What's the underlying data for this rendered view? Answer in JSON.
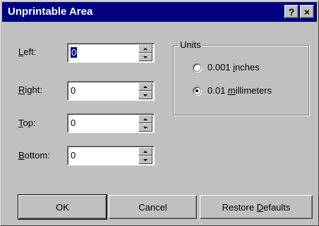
{
  "window": {
    "title": "Unprintable Area",
    "help_label": "?",
    "close_label": "×"
  },
  "fields": {
    "left": {
      "label_prefix": "",
      "label_accel": "L",
      "label_rest": "eft:",
      "value": "0"
    },
    "right": {
      "label_prefix": "",
      "label_accel": "R",
      "label_rest": "ight:",
      "value": "0"
    },
    "top": {
      "label_prefix": "",
      "label_accel": "T",
      "label_rest": "op:",
      "value": "0"
    },
    "bottom": {
      "label_prefix": "",
      "label_accel": "B",
      "label_rest": "ottom:",
      "value": "0"
    }
  },
  "units": {
    "legend": "Units",
    "inches": {
      "prefix": "0.001 ",
      "accel": "i",
      "rest": "nches",
      "selected": false
    },
    "millimeters": {
      "prefix": "0.01 ",
      "accel": "m",
      "rest": "illimeters",
      "selected": true
    }
  },
  "buttons": {
    "ok": "OK",
    "cancel": "Cancel",
    "restore_prefix": "Restore ",
    "restore_accel": "D",
    "restore_rest": "efaults"
  }
}
